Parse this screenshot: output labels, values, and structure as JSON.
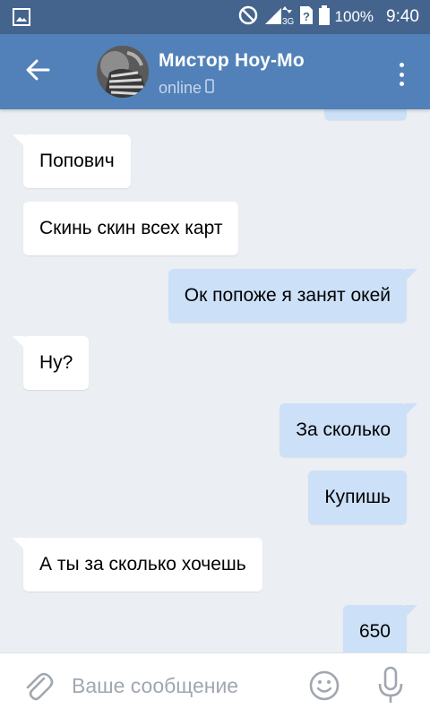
{
  "status_bar": {
    "battery": "100%",
    "time": "9:40",
    "network": "3G",
    "icons": [
      "image-icon",
      "do-not-disturb-icon",
      "signal-icon",
      "sim-unknown-icon",
      "battery-icon"
    ]
  },
  "header": {
    "contact_name": "Мистор Ноу-Мо",
    "contact_status": "online",
    "icons": [
      "back-arrow-icon",
      "mobile-icon",
      "more-vert-icon"
    ]
  },
  "messages": [
    {
      "direction": "out",
      "text": ""
    },
    {
      "direction": "in",
      "text": "Попович"
    },
    {
      "direction": "in",
      "text": "Скинь скин всех карт"
    },
    {
      "direction": "out",
      "text": "Ок попоже я занят окей"
    },
    {
      "direction": "in",
      "text": "Ну?"
    },
    {
      "direction": "out",
      "text": "За сколько"
    },
    {
      "direction": "out",
      "text": "Купишь"
    },
    {
      "direction": "in",
      "text": "А ты за сколько хочешь"
    },
    {
      "direction": "out",
      "text": "650"
    }
  ],
  "composer": {
    "placeholder": "Ваше сообщение",
    "value": "",
    "icons": [
      "paperclip-icon",
      "emoji-icon",
      "microphone-icon"
    ]
  },
  "colors": {
    "header": "#5181b8",
    "status_bar": "#44648e",
    "background": "#ebeef3",
    "incoming_bubble": "#ffffff",
    "outgoing_bubble": "#cce0f7"
  }
}
